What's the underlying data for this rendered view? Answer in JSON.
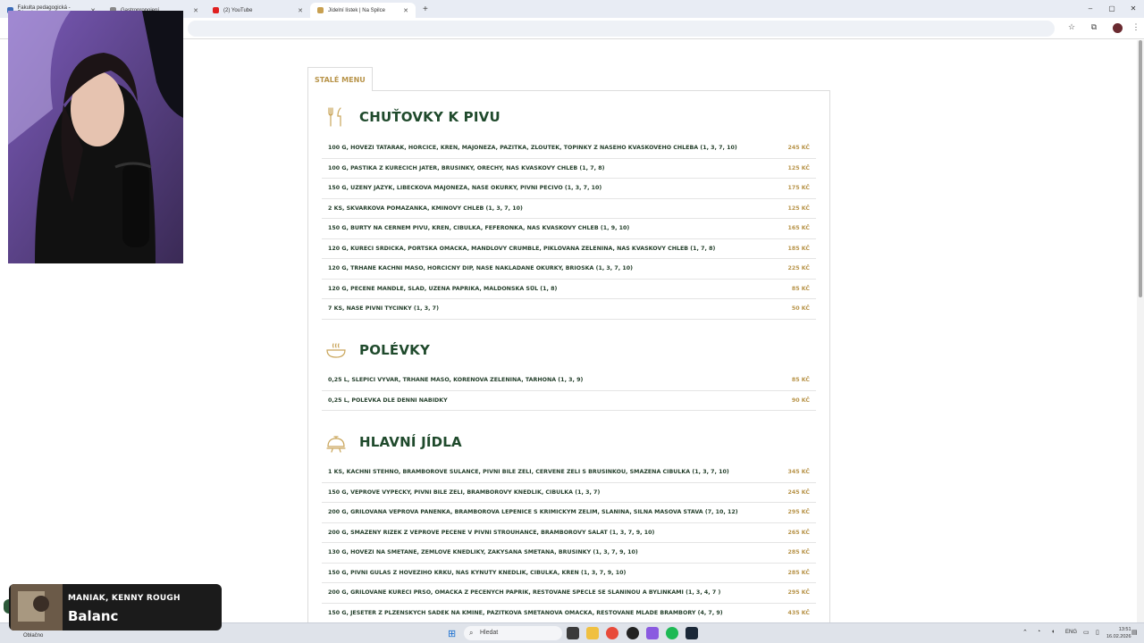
{
  "browser": {
    "tabs": [
      {
        "label": "Fakulta pedagogická - Západo",
        "active": false
      },
      {
        "label": "Gastropropojení",
        "active": false
      },
      {
        "label": "(2) YouTube",
        "active": false
      },
      {
        "label": "Jídelní lístek | Na Spilce",
        "active": true
      }
    ],
    "new_tab": "+"
  },
  "page": {
    "menu_tab_label": "STALÉ MENU",
    "sections": [
      {
        "title": "CHUŤOVKY K PIVU",
        "icon": "cutlery-icon",
        "items": [
          {
            "desc": "100 G, HOVĚZÍ TATARÁK, HOŘČICE, KŘEN, MAJONÉZA, PAŽITKA, ŽLOUTEK, TOPINKY Z NAŠEHO KVÁSKOVÉHO CHLEBA (1, 3, 7, 10)",
            "price": "245 KČ"
          },
          {
            "desc": "100 G, PAŠTIKA Z KUŘECÍCH JATER, BRUSINKY, OŘECHY, NÁŠ KVÁSKOVÝ CHLÉB (1, 7, 8)",
            "price": "125 KČ"
          },
          {
            "desc": "150 G, UZENÝ JAZYK, LIBEČKOVÁ MAJONÉZA, NAŠE OKURKY, PIVNÍ PEČIVO (1, 3, 7, 10)",
            "price": "175 KČ"
          },
          {
            "desc": "2 KS, ŠKVARKOVÁ POMAZÁNKA, KMÍNOVÝ CHLÉB (1, 3, 7, 10)",
            "price": "125 KČ"
          },
          {
            "desc": "150 G, BUŘTY NA ČERNÉM PIVU, KŘEN, CIBULKA, FEFERONKA, NÁŠ KVÁSKOVÝ CHLÉB (1, 9, 10)",
            "price": "165 KČ"
          },
          {
            "desc": "120 G, KUŘECÍ SRDÍČKA, PORTSKÁ OMÁČKA, MANDLOVÝ CRUMBLE, PIKLOVANÁ ZELENINA, NÁŠ KVÁSKOVÝ CHLÉB (1, 7, 8)",
            "price": "185 KČ"
          },
          {
            "desc": "120 G, TRHANÉ KACHNÍ MASO, HOŘČIČNÝ DIP, NAŠE NAKLÁDANÉ OKURKY, BRIOŠKA (1, 3, 7, 10)",
            "price": "225 KČ"
          },
          {
            "desc": "120 G, PEČENÉ MANDLE, SLAD, UZENÁ PAPRIKA, MALDONSKÁ SŮL (1, 8)",
            "price": "85 KČ"
          },
          {
            "desc": "7 KS, NAŠE PIVNÍ TYČINKY (1, 3, 7)",
            "price": "50 KČ"
          }
        ]
      },
      {
        "title": "POLÉVKY",
        "icon": "soup-bowl-icon",
        "items": [
          {
            "desc": "0,25 L, SLEPIČÍ VÝVAR, TRHANÉ MASO, KOŘENOVÁ ZELENINA, TARHOŇA (1, 3, 9)",
            "price": "85 KČ"
          },
          {
            "desc": "0,25 L, POLÉVKA DLE DENNÍ NABÍDKY",
            "price": "90 KČ"
          }
        ]
      },
      {
        "title": "HLAVNÍ JÍDLA",
        "icon": "cloche-icon",
        "items": [
          {
            "desc": "1 KS, KACHNÍ STEHNO, BRAMBOROVÉ ŠULANCE, PIVNÍ BÍLÉ ZELÍ, ČERVENÉ ZELÍ S BRUSINKOU, SMAŽENÁ CIBULKA (1, 3, 7, 10)",
            "price": "345 KČ"
          },
          {
            "desc": "150 G, VEPŘOVÉ VÝPEČKY, PIVNÍ BÍLÉ ZELÍ, BRAMBOROVÝ KNEDLÍK, CIBULKA (1, 3, 7)",
            "price": "245 KČ"
          },
          {
            "desc": "200 G, GRILOVANÁ VEPŘOVÁ PANENKA, BRAMBOROVÁ LEPENICE S KŘIMICKÝM ZELÍM, SLANINA, SILNÁ MASOVÁ ŠŤÁVA (7, 10, 12)",
            "price": "295 KČ"
          },
          {
            "desc": "200 G, SMAŽENÝ ŘÍZEK Z VEPŘOVÉ PEČENĚ V PIVNÍ STROUHANCE, BRAMBOROVÝ SALÁT (1, 3, 7, 9, 10)",
            "price": "265 KČ"
          },
          {
            "desc": "130 G, HOVĚZÍ NA SMETANĚ, ŽEMLOVÉ KNEDLÍKY, ZAKYSANÁ SMETANA, BRUSINKY (1, 3, 7, 9, 10)",
            "price": "285 KČ"
          },
          {
            "desc": "150 G, PIVNÍ GULÁŠ Z HOVĚZÍHO KRKU, NÁŠ KYNUTÝ KNEDLÍK, CIBULKA, KŘEN (1, 3, 7, 9, 10)",
            "price": "285 KČ"
          },
          {
            "desc": "200 G, GRILOVANÉ KUŘECÍ PRSO, OMÁČKA Z PEČENÝCH PAPRIK, RESTOVANÉ ŠPECLE SE SLANINOU A BYLINKAMI  (1, 3, 4, 7 )",
            "price": "295 KČ"
          },
          {
            "desc": "150 G, JESETER Z PLZEŇSKÝCH SÁDEK NA KMÍNĚ, PAŽITKOVÁ SMETANOVÁ OMÁČKA, RESTOVANÉ MLADÉ BRAMBORY (4, 7, 9)",
            "price": "435 KČ"
          }
        ]
      }
    ]
  },
  "now_playing": {
    "artist": "MANIAK, KENNY ROUGH",
    "song": "Balanc"
  },
  "taskbar": {
    "weather": "Oblačno",
    "search_placeholder": "Hledat",
    "language": "ENG",
    "time": "13:51",
    "date": "16.02.2026"
  },
  "colors": {
    "heading_green": "#1f4a2c",
    "price_gold": "#b8944a"
  }
}
